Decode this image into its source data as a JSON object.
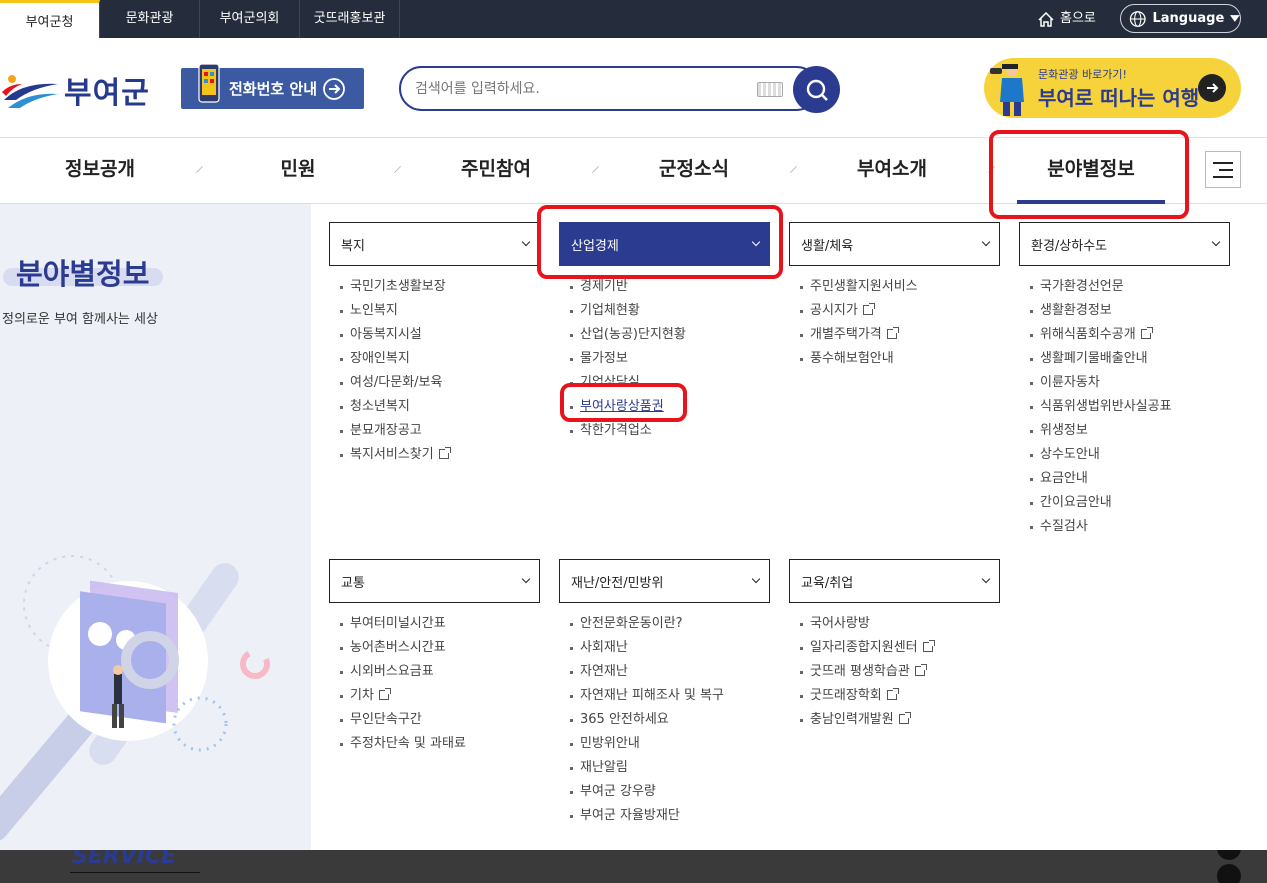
{
  "top_bar": {
    "sites": [
      "부여군청",
      "문화관광",
      "부여군의회",
      "굿뜨래홍보관"
    ],
    "home_label": "홈으로",
    "language_label": "Language"
  },
  "header": {
    "logo_text": "부여군",
    "phone_banner": "전화번호 안내",
    "search_placeholder": "검색어를 입력하세요.",
    "promo_sub": "문화관광 바로가기!",
    "promo_main": "부여로 떠나는 여행"
  },
  "gnb": {
    "items": [
      "정보공개",
      "민원",
      "주민참여",
      "군정소식",
      "부여소개",
      "분야별정보"
    ]
  },
  "side": {
    "title": "분야별정보",
    "desc": "정의로운 부여 함께사는 세상"
  },
  "categories": [
    {
      "title": "복지",
      "items": [
        {
          "label": "국민기초생활보장"
        },
        {
          "label": "노인복지"
        },
        {
          "label": "아동복지시설"
        },
        {
          "label": "장애인복지"
        },
        {
          "label": "여성/다문화/보육"
        },
        {
          "label": "청소년복지"
        },
        {
          "label": "분묘개장공고"
        },
        {
          "label": "복지서비스찾기",
          "external": true
        }
      ]
    },
    {
      "title": "산업경제",
      "items": [
        {
          "label": "경제기반"
        },
        {
          "label": "기업체현황"
        },
        {
          "label": "산업(농공)단지현황"
        },
        {
          "label": "물가정보"
        },
        {
          "label": "기업상담실"
        },
        {
          "label": "부여사랑상품권"
        },
        {
          "label": "착한가격업소"
        }
      ]
    },
    {
      "title": "생활/체육",
      "items": [
        {
          "label": "주민생활지원서비스"
        },
        {
          "label": "공시지가",
          "external": true
        },
        {
          "label": "개별주택가격",
          "external": true
        },
        {
          "label": "풍수해보험안내"
        }
      ]
    },
    {
      "title": "환경/상하수도",
      "items": [
        {
          "label": "국가환경선언문"
        },
        {
          "label": "생활환경정보"
        },
        {
          "label": "위해식품회수공개",
          "external": true
        },
        {
          "label": "생활폐기물배출안내"
        },
        {
          "label": "이륜자동차"
        },
        {
          "label": "식품위생법위반사실공표"
        },
        {
          "label": "위생정보"
        },
        {
          "label": "상수도안내"
        },
        {
          "label": "요금안내"
        },
        {
          "label": "간이요금안내"
        },
        {
          "label": "수질검사"
        }
      ]
    },
    {
      "title": "교통",
      "items": [
        {
          "label": "부여터미널시간표"
        },
        {
          "label": "농어촌버스시간표"
        },
        {
          "label": "시외버스요금표"
        },
        {
          "label": "기차",
          "external": true
        },
        {
          "label": "무인단속구간"
        },
        {
          "label": "주정차단속 및 과태료"
        }
      ]
    },
    {
      "title": "재난/안전/민방위",
      "items": [
        {
          "label": "안전문화운동이란?"
        },
        {
          "label": "사회재난"
        },
        {
          "label": "자연재난"
        },
        {
          "label": "자연재난 피해조사 및 복구"
        },
        {
          "label": "365 안전하세요"
        },
        {
          "label": "민방위안내"
        },
        {
          "label": "재난알림"
        },
        {
          "label": "부여군 강우량"
        },
        {
          "label": "부여군 자율방재단"
        }
      ]
    },
    {
      "title": "교육/취업",
      "items": [
        {
          "label": "국어사랑방"
        },
        {
          "label": "일자리종합지원센터",
          "external": true
        },
        {
          "label": "굿뜨래 평생학습관",
          "external": true
        },
        {
          "label": "굿뜨래장학회",
          "external": true
        },
        {
          "label": "충남인력개발원",
          "external": true
        }
      ]
    }
  ],
  "bottom": {
    "service_label": "SERVICE"
  },
  "colors": {
    "navy": "#2b3b8f",
    "topbar": "#252d3c",
    "highlight": "#e8141b",
    "promo_yellow": "#f6d33b"
  }
}
